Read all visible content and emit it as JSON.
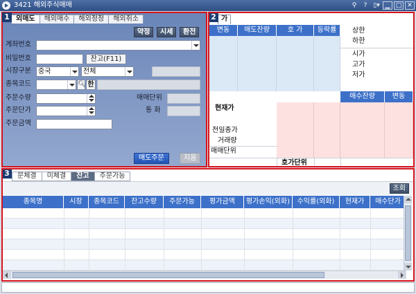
{
  "window": {
    "title": "3421 해외주식매매",
    "buttons": {
      "pin": "⚲",
      "help": "?",
      "menu": "▯▾",
      "minimize": "▁",
      "maximize": "□",
      "close": "✕"
    }
  },
  "panel1": {
    "badge": "1",
    "tabs": [
      "외매도",
      "해외매수",
      "해외정정",
      "해외취소"
    ],
    "actions": {
      "balance": "약정",
      "quote": "시세",
      "exchange": "환전"
    },
    "labels": {
      "account": "계좌번호",
      "password": "비밀번호",
      "market": "시장구분",
      "stock_code": "종목코드",
      "quantity": "주문수량",
      "price": "주문단가",
      "amount": "주문금액",
      "trade_unit": "매매단위",
      "currency": "통 화"
    },
    "values": {
      "market": "중국",
      "scope": "전체"
    },
    "buttons": {
      "balance_lookup": "잔고(F11)",
      "han": "한",
      "sell_order": "매도주문",
      "clear": "지움"
    }
  },
  "panel2": {
    "badge": "2",
    "tab": "가",
    "headers": [
      "변동",
      "매도잔량",
      "호 가",
      "등락률"
    ],
    "limits": [
      "상한",
      "하한"
    ],
    "prices": [
      "시가",
      "고가",
      "저가"
    ],
    "bid_headers": [
      "매수잔량",
      "변동"
    ],
    "current_price": "현재가",
    "prev_close": "전일종가",
    "volume": "거래량",
    "trade_unit": "매매단위",
    "tick_unit": "호가단위"
  },
  "panel3": {
    "badge": "3",
    "tabs": [
      "문체결",
      "미체결",
      "잔고",
      "주문가능"
    ],
    "active_tab": 2,
    "inquire": "조회",
    "columns": [
      "종목명",
      "시장",
      "종목코드",
      "잔고수량",
      "주문가능",
      "평가금액",
      "평가손익(외화)",
      "수익률(외화)",
      "현재가",
      "매수단가"
    ]
  },
  "colors": {
    "frame": "#d8141d",
    "header_blue": "#3d71c9",
    "panel_blue": "#6b86b8",
    "ask_pink": "#fde1e1",
    "bid_blue": "#dbe9f7"
  }
}
